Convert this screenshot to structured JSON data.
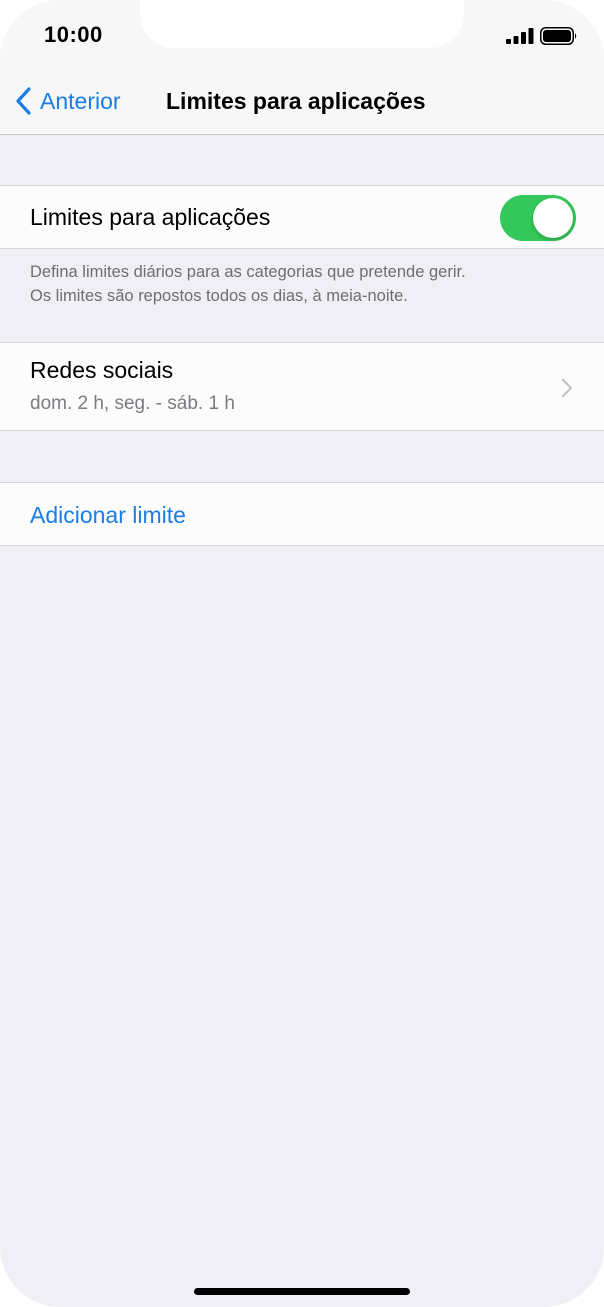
{
  "status_bar": {
    "time": "10:00",
    "signal_icon": "signal-bars-icon",
    "battery_icon": "battery-full-icon"
  },
  "nav": {
    "back_label": "Anterior",
    "back_icon": "chevron-left-icon",
    "title": "Limites para aplicações"
  },
  "toggle_section": {
    "label": "Limites para aplicações",
    "enabled": true,
    "accent_color": "#34c759"
  },
  "footer": {
    "line1": "Defina limites diários para as categorias que pretende gerir.",
    "line2": "Os limites são repostos todos os dias, à meia-noite."
  },
  "limits": [
    {
      "title": "Redes sociais",
      "subtitle": "dom. 2 h, seg. - sáb. 1 h",
      "icon": "chevron-right-icon"
    }
  ],
  "add_limit": {
    "label": "Adicionar limite",
    "color": "#1a7ee6"
  }
}
